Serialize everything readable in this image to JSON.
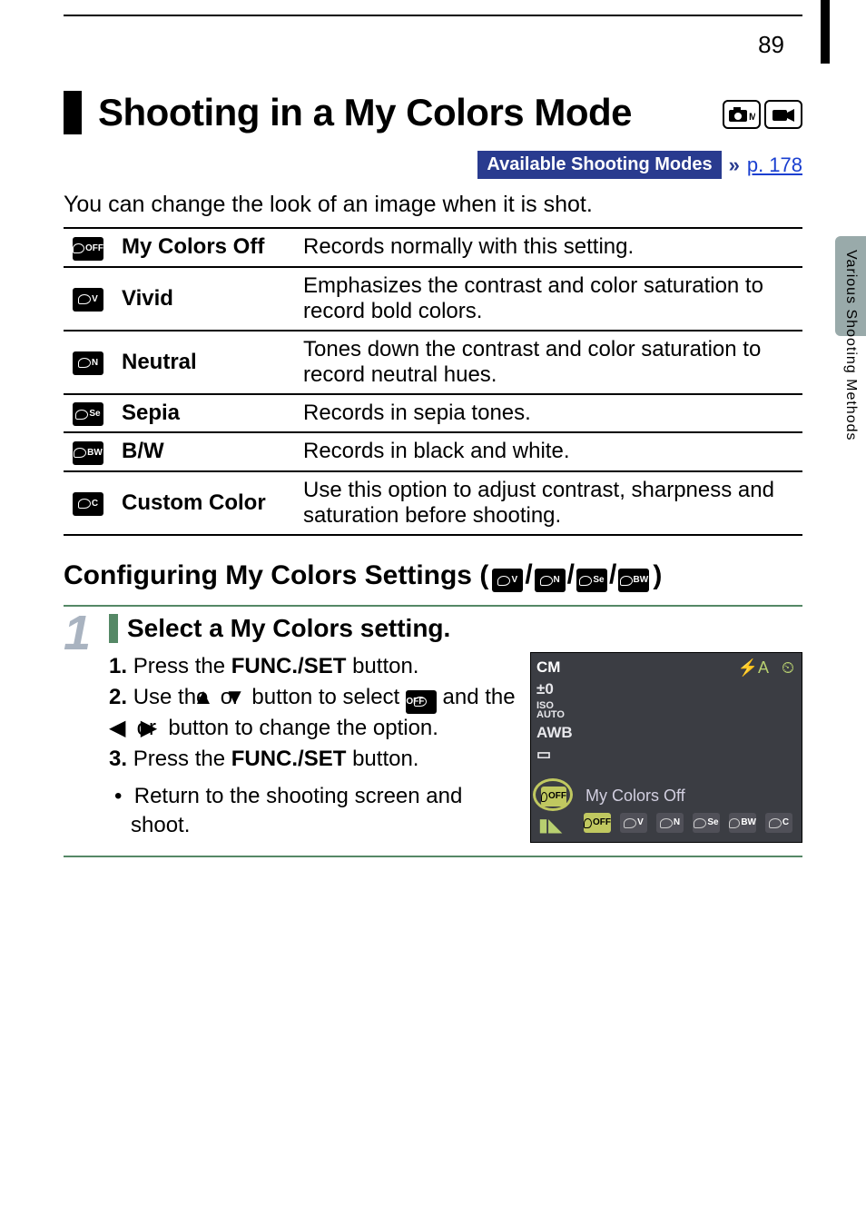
{
  "page_number": "89",
  "side_tab_label": "Various Shooting Methods",
  "title": "Shooting in a My Colors Mode",
  "title_mode_icons": [
    "camera-m-icon",
    "movie-icon"
  ],
  "asm": {
    "label": "Available Shooting Modes",
    "link_text": "p. 178"
  },
  "intro": "You can change the look of an image when it is shot.",
  "table": [
    {
      "icon_sub": "OFF",
      "name": "My Colors Off",
      "desc": "Records normally with this setting."
    },
    {
      "icon_sub": "V",
      "name": "Vivid",
      "desc": "Emphasizes the contrast and color saturation to record bold colors."
    },
    {
      "icon_sub": "N",
      "name": "Neutral",
      "desc": "Tones down the contrast and color saturation to record neutral hues."
    },
    {
      "icon_sub": "Se",
      "name": "Sepia",
      "desc": "Records in sepia tones."
    },
    {
      "icon_sub": "BW",
      "name": "B/W",
      "desc": "Records in black and white."
    },
    {
      "icon_sub": "C",
      "name": "Custom Color",
      "desc": "Use this option to adjust contrast, sharpness and saturation before shooting."
    }
  ],
  "section2_prefix": "Configuring My Colors Settings (",
  "section2_icons": [
    "V",
    "N",
    "Se",
    "BW"
  ],
  "section2_suffix": ")",
  "step": {
    "num": "1",
    "title": "Select a My Colors setting.",
    "items": [
      {
        "n": "1.",
        "pre": "Press the ",
        "btn": "FUNC./SET",
        "post": " button."
      },
      {
        "n": "2.",
        "text_a": "Use the ",
        "text_b": " or ",
        "text_c": " button to select ",
        "text_d": " and the ",
        "text_e": " or ",
        "text_f": " button to change the option."
      },
      {
        "n": "3.",
        "pre": "Press the ",
        "btn": "FUNC./SET",
        "post": " button."
      }
    ],
    "bullet": "Return to the shooting screen and shoot."
  },
  "lcd": {
    "cm": "CM",
    "col": [
      "±0",
      "ISO\nAUTO",
      "AWB",
      "▭"
    ],
    "topr_flash": "⚡A",
    "topr_timer": "⏲",
    "label": "My Colors Off",
    "row": [
      "OFF",
      "V",
      "N",
      "Se",
      "BW",
      "C"
    ],
    "selected": "OFF"
  }
}
